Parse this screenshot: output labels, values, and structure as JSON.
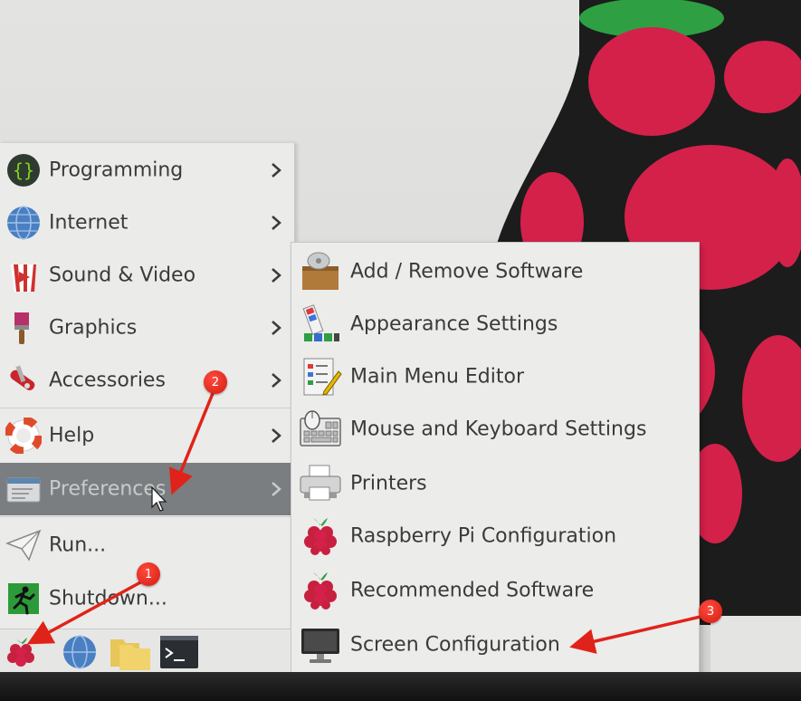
{
  "main_menu": {
    "items": [
      {
        "label": "Programming",
        "icon": "programming-icon"
      },
      {
        "label": "Internet",
        "icon": "globe-icon"
      },
      {
        "label": "Sound & Video",
        "icon": "popcorn-icon"
      },
      {
        "label": "Graphics",
        "icon": "paintbrush-icon"
      },
      {
        "label": "Accessories",
        "icon": "swiss-knife-icon"
      },
      {
        "label": "Help",
        "icon": "lifebuoy-icon"
      },
      {
        "label": "Preferences",
        "icon": "preferences-icon"
      },
      {
        "label": "Run...",
        "icon": "paper-plane-icon"
      },
      {
        "label": "Shutdown...",
        "icon": "exit-icon"
      }
    ]
  },
  "preferences_submenu": {
    "items": [
      {
        "label": "Add / Remove Software",
        "icon": "package-icon"
      },
      {
        "label": "Appearance Settings",
        "icon": "appearance-icon"
      },
      {
        "label": "Main Menu Editor",
        "icon": "menu-editor-icon"
      },
      {
        "label": "Mouse and Keyboard Settings",
        "icon": "mouse-keyboard-icon"
      },
      {
        "label": "Printers",
        "icon": "printer-icon"
      },
      {
        "label": "Raspberry Pi Configuration",
        "icon": "raspberry-icon"
      },
      {
        "label": "Recommended Software",
        "icon": "raspberry-icon"
      },
      {
        "label": "Screen Configuration",
        "icon": "monitor-icon"
      }
    ]
  },
  "taskbar": {
    "items": [
      "raspberry-menu-icon",
      "web-browser-icon",
      "file-manager-icon",
      "terminal-icon"
    ]
  },
  "annotations": {
    "badges": [
      "1",
      "2",
      "3"
    ],
    "color": "#e0231a"
  },
  "colors": {
    "raspberry": "#d4214a",
    "wallpaper_dark": "#1c1c1c",
    "selected_row": "#7a7e80"
  }
}
